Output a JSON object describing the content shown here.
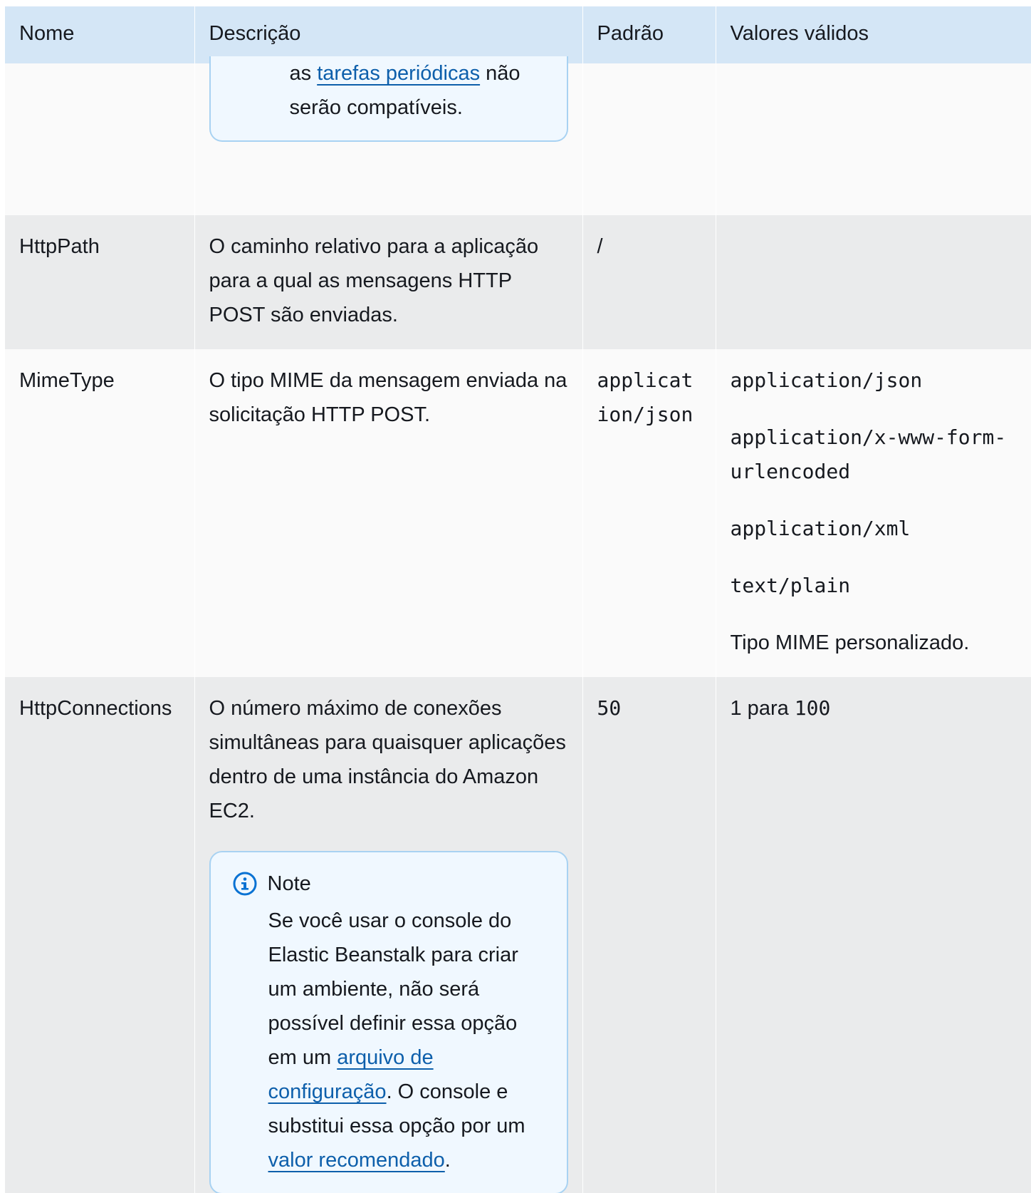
{
  "headers": {
    "name": "Nome",
    "description": "Descrição",
    "default": "Padrão",
    "valid_values": "Valores válidos"
  },
  "prev_note": {
    "text_before": "as ",
    "link": "tarefas periódicas",
    "text_after": " não serão compatíveis."
  },
  "rows": [
    {
      "name": "HttpPath",
      "description": "O caminho relativo para a aplicação para a qual as mensagens HTTP POST são enviadas.",
      "default": "/",
      "valid_values": []
    },
    {
      "name": "MimeType",
      "description": "O tipo MIME da mensagem enviada na solicitação HTTP POST.",
      "default": "application/json",
      "valid_values": [
        "application/json",
        "application/x-www-form-urlencoded",
        "application/xml",
        "text/plain",
        "Tipo MIME personalizado."
      ]
    },
    {
      "name": "HttpConnections",
      "description": "O número máximo de conexões simultâneas para quaisquer aplicações dentro de uma instância do Amazon EC2.",
      "default": "50",
      "valid_values_prefix": "1 para ",
      "valid_values_code": "100",
      "note": {
        "title": "Note",
        "icon": "info-icon",
        "text_1": "Se você usar o console do Elastic Beanstalk para criar um ambiente, não será possível definir essa opção em um ",
        "link_1": "arquivo de configuração",
        "text_2": ". O console e substitui essa opção por um ",
        "link_2": "valor recomendado",
        "text_3": "."
      }
    }
  ],
  "colors": {
    "header_bg": "#d4e6f6",
    "row_light": "#fafafa",
    "row_dark": "#eaebec",
    "link": "#0d5fab",
    "note_border": "#a8d2f2",
    "note_bg": "#f0f8ff",
    "icon": "#0972d3"
  }
}
